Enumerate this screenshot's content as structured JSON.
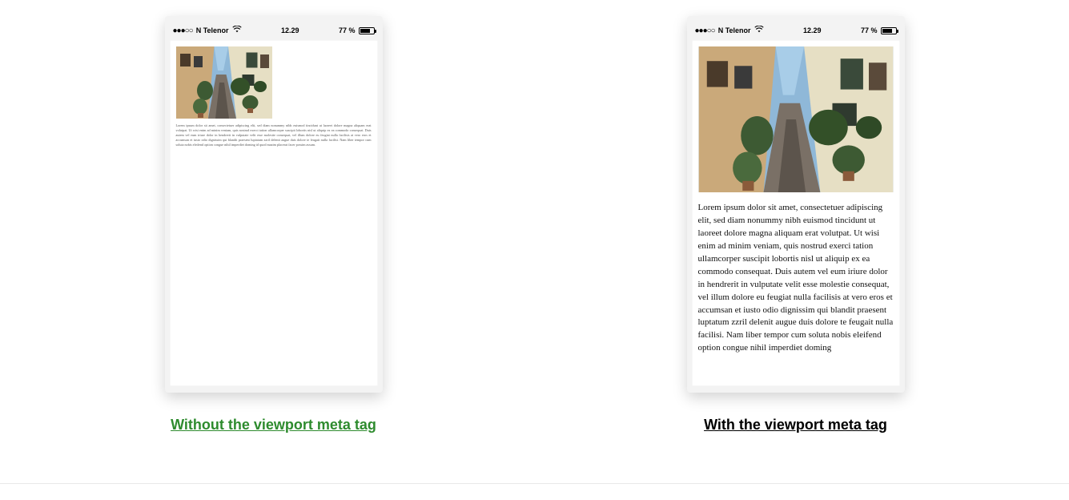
{
  "statusbar": {
    "signal_dots": "●●●○○",
    "carrier": "N Telenor",
    "wifi_icon": "wifi",
    "time": "12.29",
    "battery_percent": "77 %",
    "battery_level_pct": 77
  },
  "left": {
    "caption": "Without the viewport meta tag",
    "image_alt": "Narrow European alley with stone houses and plants",
    "body_text": "Lorem ipsum dolor sit amet, consectetuer adipiscing elit, sed diam nonummy nibh euismod tincidunt ut laoreet dolore magna aliquam erat volutpat. Ut wisi enim ad minim veniam, quis nostrud exerci tation ullamcorper suscipit lobortis nisl ut aliquip ex ea commodo consequat. Duis autem vel eum iriure dolor in hendrerit in vulputate velit esse molestie consequat, vel illum dolore eu feugiat nulla facilisis at vero eros et accumsan et iusto odio dignissim qui blandit praesent luptatum zzril delenit augue duis dolore te feugait nulla facilisi. Nam liber tempor cum soluta nobis eleifend option congue nihil imperdiet doming id quod mazim placerat facer possim assum."
  },
  "right": {
    "caption": "With the viewport meta tag",
    "image_alt": "Narrow European alley with stone houses and plants",
    "body_text": "Lorem ipsum dolor sit amet, consectetuer adipiscing elit, sed diam nonummy nibh euismod tincidunt ut laoreet dolore magna aliquam erat volutpat. Ut wisi enim ad minim veniam, quis nostrud exerci tation ullamcorper suscipit lobortis nisl ut aliquip ex ea commodo consequat. Duis autem vel eum iriure dolor in hendrerit in vulputate velit esse molestie consequat, vel illum dolore eu feugiat nulla facilisis at vero eros et accumsan et iusto odio dignissim qui blandit praesent luptatum zzril delenit augue duis dolore te feugait nulla facilisi. Nam liber tempor cum soluta nobis eleifend option congue nihil imperdiet doming"
  }
}
